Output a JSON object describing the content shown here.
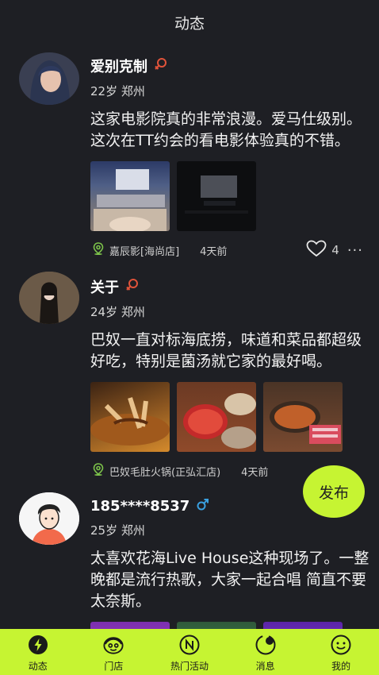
{
  "header": {
    "title": "动态"
  },
  "posts": [
    {
      "name": "爱别克制",
      "age_city": "22岁 郑州",
      "text": "这家电影院真的非常浪漫。爱马仕级别。这次在TT约会的看电影体验真的不错。",
      "location": "嘉辰影[海尚店]",
      "time": "4天前",
      "likes": "4",
      "more": "···"
    },
    {
      "name": "关于",
      "age_city": "24岁 郑州",
      "text": "巴奴一直对标海底捞，味道和菜品都超级好吃，特别是菌汤就它家的最好喝。",
      "location": "巴奴毛肚火锅(正弘汇店)",
      "time": "4天前"
    },
    {
      "name": "185****8537",
      "age_city": "25岁 郑州",
      "text": "太喜欢花海Live House这种现场了。一整晚都是流行热歌，大家一起合唱 简直不要太奈斯。"
    }
  ],
  "publish_label": "发布",
  "tabs": [
    {
      "label": "动态",
      "icon": "lightning-icon"
    },
    {
      "label": "门店",
      "icon": "store-icon"
    },
    {
      "label": "热门活动",
      "icon": "hot-activity-icon"
    },
    {
      "label": "消息",
      "icon": "message-icon"
    },
    {
      "label": "我的",
      "icon": "smile-icon"
    }
  ],
  "colors": {
    "background": "#1e1f24",
    "accent": "#c6f432",
    "female": "#e0533a",
    "male": "#3aa0e0"
  }
}
